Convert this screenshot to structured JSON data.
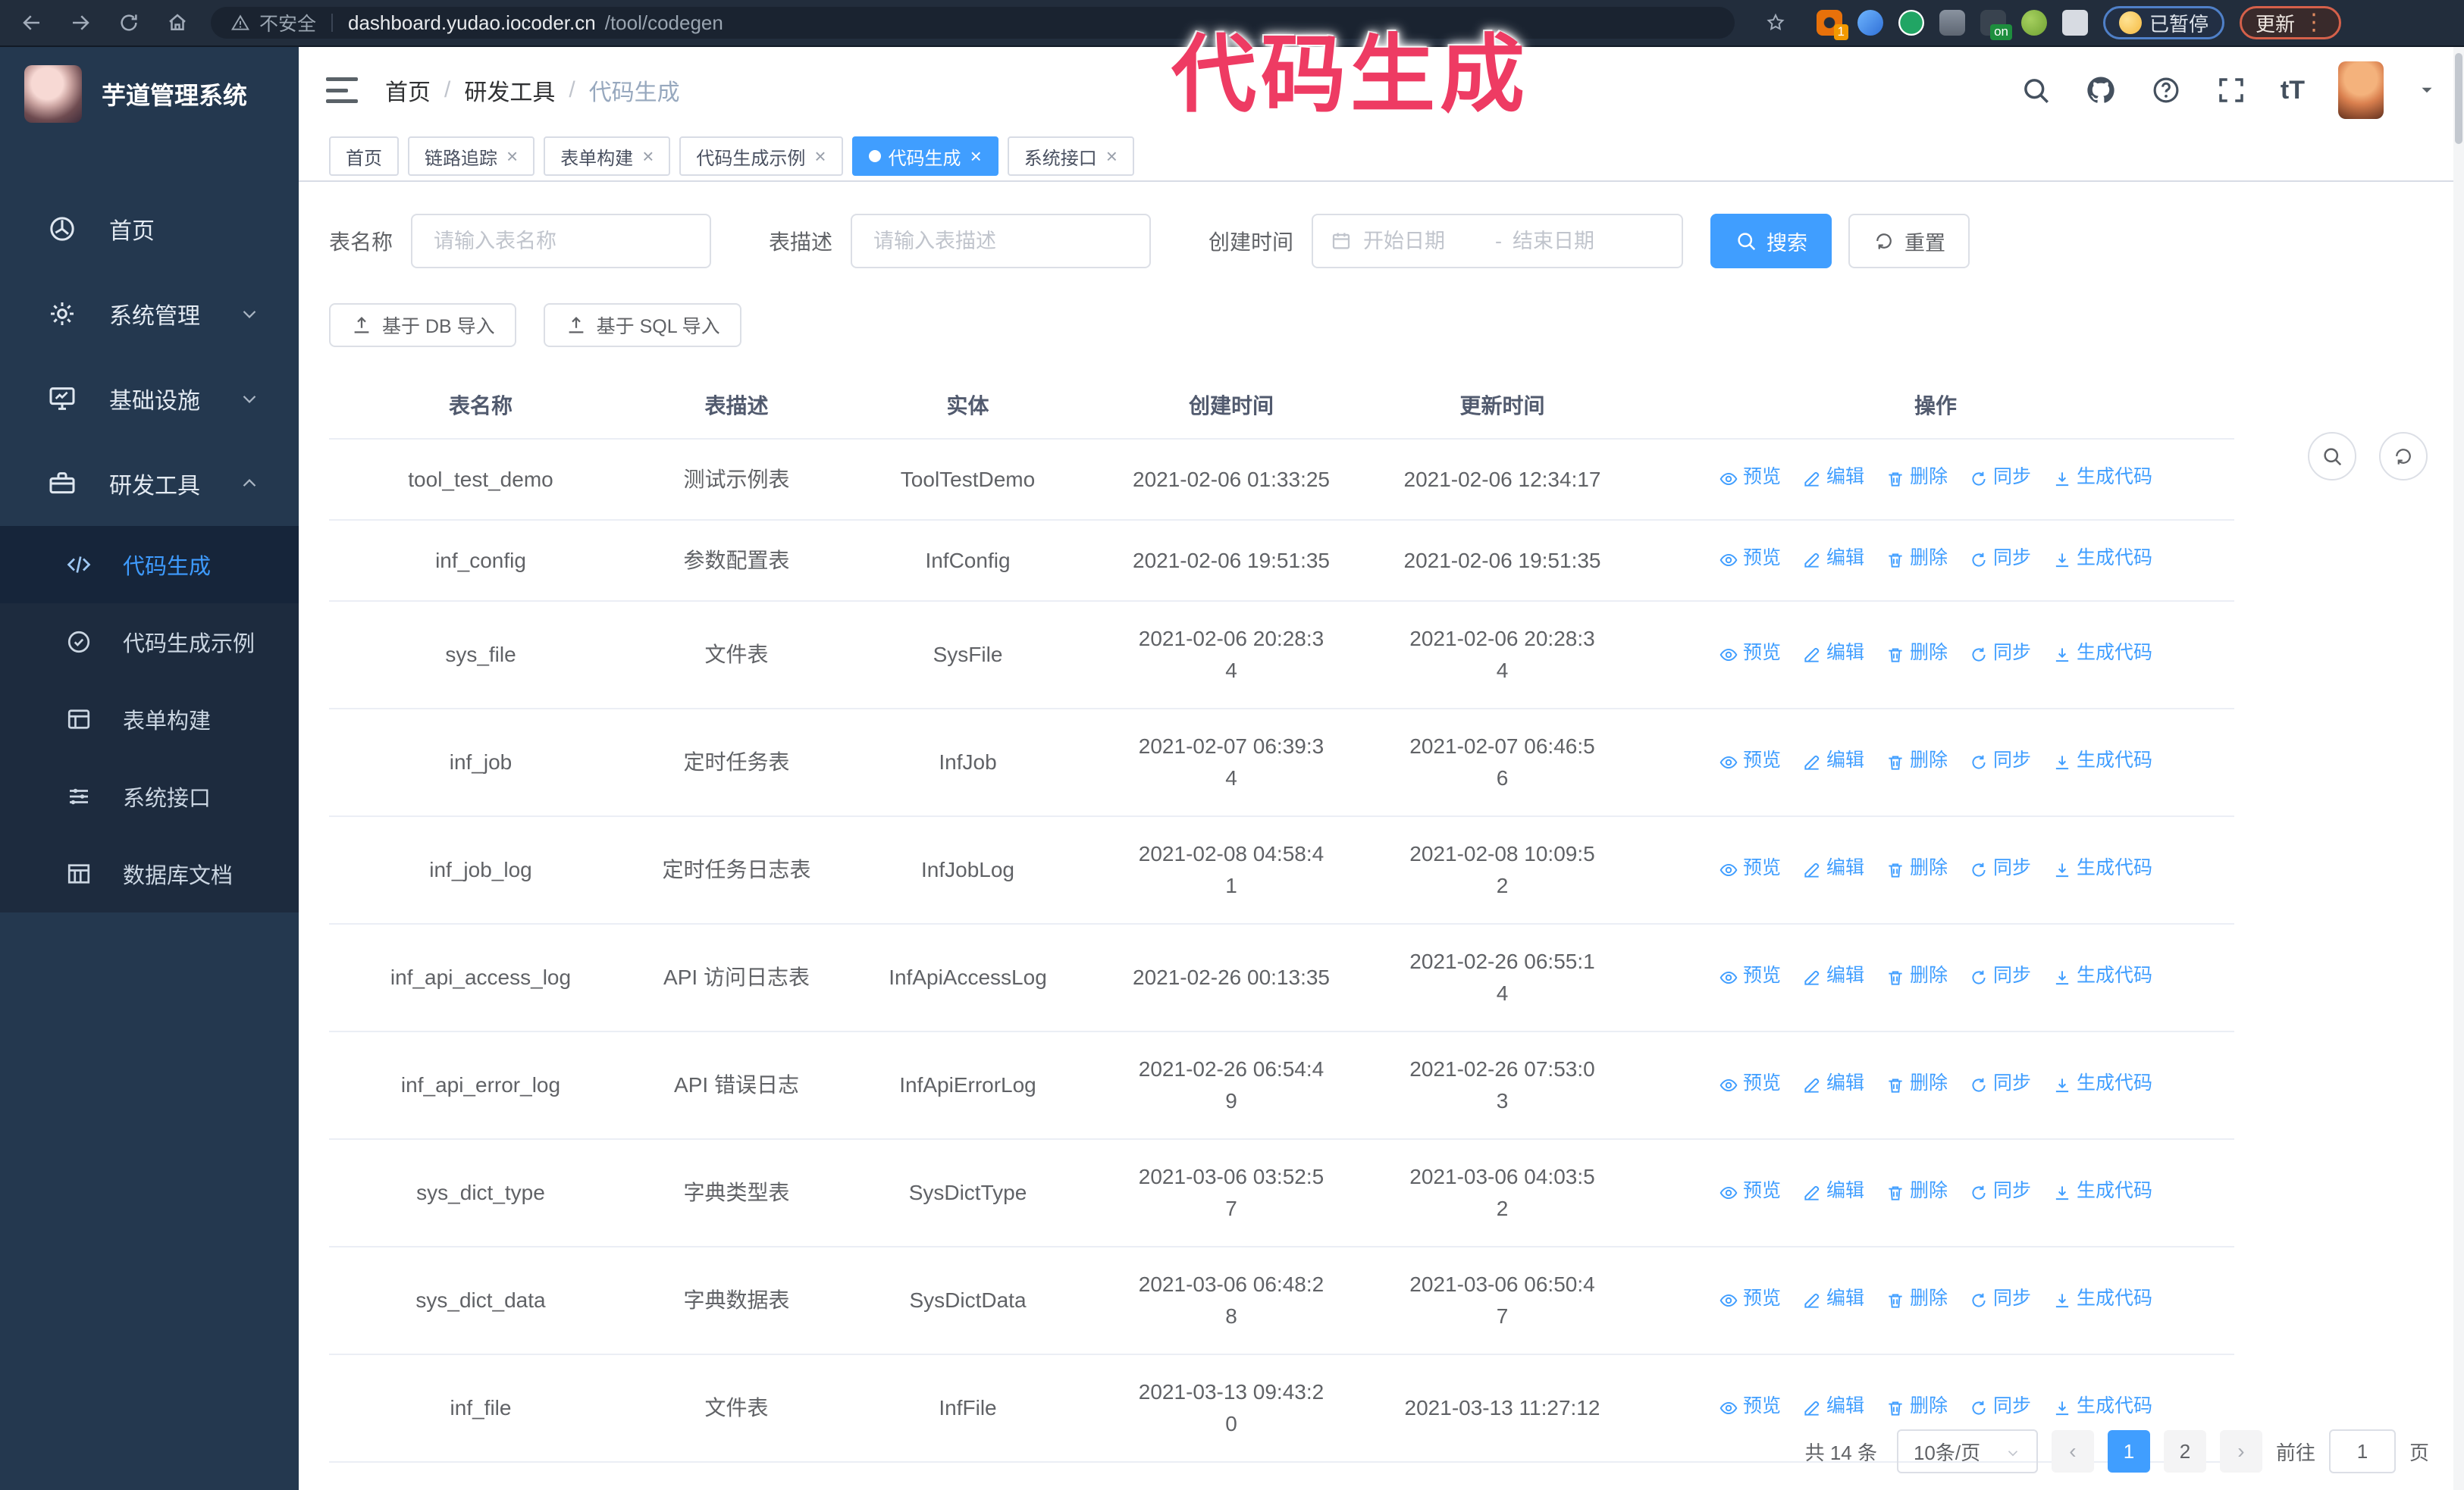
{
  "browser": {
    "security_label": "不安全",
    "url_host": "dashboard.yudao.iocoder.cn",
    "url_path": "/tool/codegen",
    "ext_badge_count": "1",
    "ext_badge_on": "on",
    "paused_label": "已暂停",
    "update_label": "更新"
  },
  "annotation": {
    "text": "代码生成",
    "color": "#ee3b63"
  },
  "sidebar": {
    "app_title": "芋道管理系统",
    "items": [
      {
        "icon": "dashboard-icon",
        "label": "首页",
        "chevron_down": false,
        "chevron_up": false
      },
      {
        "icon": "gear-icon",
        "label": "系统管理",
        "chevron_down": true,
        "chevron_up": false
      },
      {
        "icon": "infra-icon",
        "label": "基础设施",
        "chevron_down": true,
        "chevron_up": false
      },
      {
        "icon": "tools-icon",
        "label": "研发工具",
        "chevron_down": false,
        "chevron_up": true
      }
    ],
    "submenu": [
      {
        "icon": "code-icon",
        "label": "代码生成",
        "active": true
      },
      {
        "icon": "example-icon",
        "label": "代码生成示例",
        "active": false
      },
      {
        "icon": "form-icon",
        "label": "表单构建",
        "active": false
      },
      {
        "icon": "api-icon",
        "label": "系统接口",
        "active": false
      },
      {
        "icon": "dbdoc-icon",
        "label": "数据库文档",
        "active": false
      }
    ]
  },
  "header": {
    "separator": "/",
    "breadcrumb": [
      {
        "label": "首页",
        "current": false
      },
      {
        "label": "研发工具",
        "current": false
      },
      {
        "label": "代码生成",
        "current": true
      }
    ]
  },
  "tabs": [
    {
      "label": "首页",
      "closable": false,
      "active": false
    },
    {
      "label": "链路追踪",
      "closable": true,
      "active": false
    },
    {
      "label": "表单构建",
      "closable": true,
      "active": false
    },
    {
      "label": "代码生成示例",
      "closable": true,
      "active": false
    },
    {
      "label": "代码生成",
      "closable": true,
      "active": true
    },
    {
      "label": "系统接口",
      "closable": true,
      "active": false
    }
  ],
  "filters": {
    "name_label": "表名称",
    "name_placeholder": "请输入表名称",
    "desc_label": "表描述",
    "desc_placeholder": "请输入表描述",
    "time_label": "创建时间",
    "start_placeholder": "开始日期",
    "range_separator": "-",
    "end_placeholder": "结束日期",
    "search_label": "搜索",
    "reset_label": "重置"
  },
  "toolbar": {
    "db_import_label": "基于 DB 导入",
    "sql_import_label": "基于 SQL 导入"
  },
  "table": {
    "columns": [
      "表名称",
      "表描述",
      "实体",
      "创建时间",
      "更新时间",
      "操作"
    ],
    "rows": [
      {
        "name": "tool_test_demo",
        "desc": "测试示例表",
        "entity": "ToolTestDemo",
        "created": "2021-02-06 01:33:25",
        "updated": "2021-02-06 12:34:17"
      },
      {
        "name": "inf_config",
        "desc": "参数配置表",
        "entity": "InfConfig",
        "created": "2021-02-06 19:51:35",
        "updated": "2021-02-06 19:51:35"
      },
      {
        "name": "sys_file",
        "desc": "文件表",
        "entity": "SysFile",
        "created": "2021-02-06 20:28:3\n4",
        "updated": "2021-02-06 20:28:3\n4"
      },
      {
        "name": "inf_job",
        "desc": "定时任务表",
        "entity": "InfJob",
        "created": "2021-02-07 06:39:3\n4",
        "updated": "2021-02-07 06:46:5\n6"
      },
      {
        "name": "inf_job_log",
        "desc": "定时任务日志表",
        "entity": "InfJobLog",
        "created": "2021-02-08 04:58:4\n1",
        "updated": "2021-02-08 10:09:5\n2"
      },
      {
        "name": "inf_api_access_log",
        "desc": "API 访问日志表",
        "entity": "InfApiAccessLog",
        "created": "2021-02-26 00:13:35",
        "updated": "2021-02-26 06:55:1\n4"
      },
      {
        "name": "inf_api_error_log",
        "desc": "API 错误日志",
        "entity": "InfApiErrorLog",
        "created": "2021-02-26 06:54:4\n9",
        "updated": "2021-02-26 07:53:0\n3"
      },
      {
        "name": "sys_dict_type",
        "desc": "字典类型表",
        "entity": "SysDictType",
        "created": "2021-03-06 03:52:5\n7",
        "updated": "2021-03-06 04:03:5\n2"
      },
      {
        "name": "sys_dict_data",
        "desc": "字典数据表",
        "entity": "SysDictData",
        "created": "2021-03-06 06:48:2\n8",
        "updated": "2021-03-06 06:50:4\n7"
      },
      {
        "name": "inf_file",
        "desc": "文件表",
        "entity": "InfFile",
        "created": "2021-03-13 09:43:2\n0",
        "updated": "2021-03-13 11:27:12"
      }
    ],
    "row_actions": [
      {
        "icon": "eye-icon",
        "label": "预览",
        "name": "preview-action"
      },
      {
        "icon": "edit-icon",
        "label": "编辑",
        "name": "edit-action"
      },
      {
        "icon": "delete-icon",
        "label": "删除",
        "name": "delete-action"
      },
      {
        "icon": "sync-icon",
        "label": "同步",
        "name": "sync-action"
      },
      {
        "icon": "generate-icon",
        "label": "生成代码",
        "name": "generate-code-action"
      }
    ]
  },
  "pagination": {
    "total": "共 14 条",
    "page_size": "10条/页",
    "prev": "‹",
    "next": "›",
    "pages": [
      "1",
      "2"
    ],
    "active_page": "1",
    "goto_label": "前往",
    "goto_value": "1",
    "page_unit": "页"
  }
}
